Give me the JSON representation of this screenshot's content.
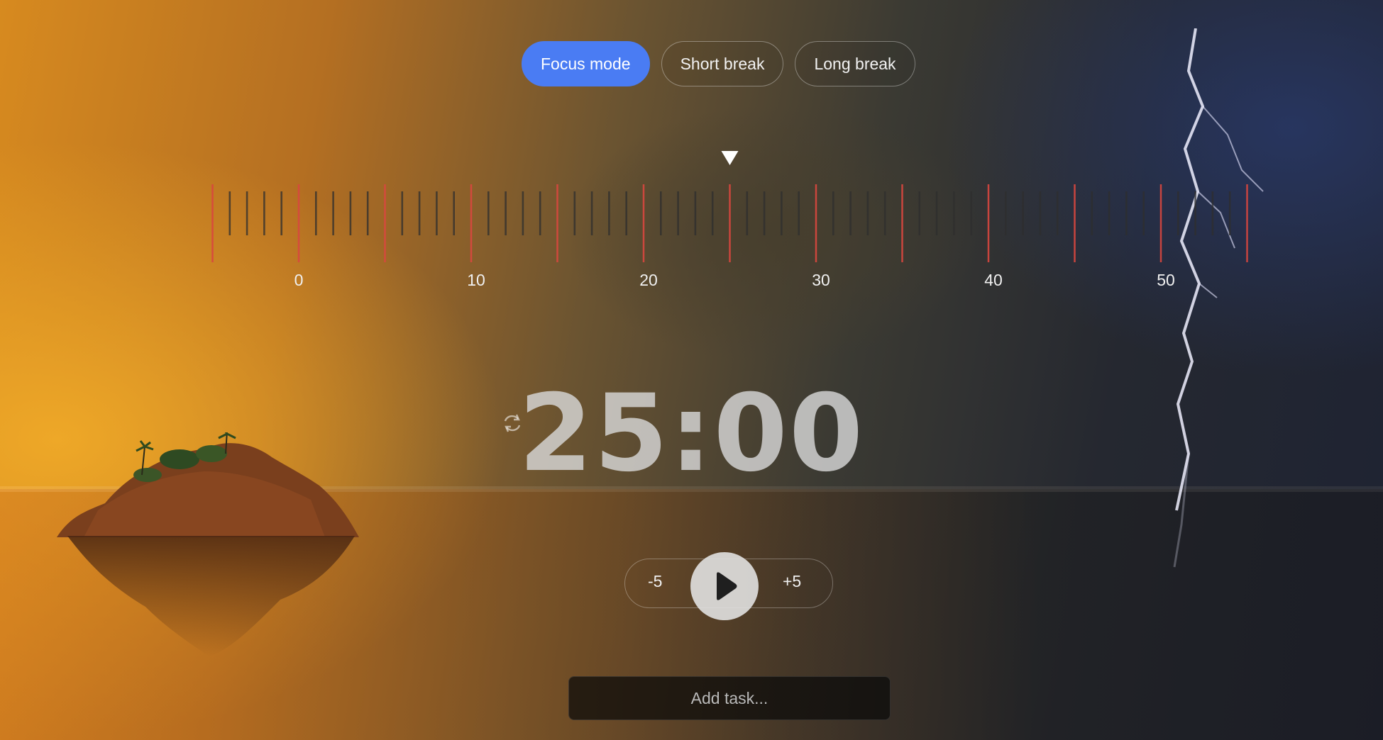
{
  "modes": [
    {
      "label": "Focus mode",
      "active": true
    },
    {
      "label": "Short break",
      "active": false
    },
    {
      "label": "Long break",
      "active": false
    }
  ],
  "ruler": {
    "labels": [
      "0",
      "10",
      "20",
      "30",
      "40",
      "50"
    ],
    "pointer_minutes": 25
  },
  "timer": {
    "display": "25:00"
  },
  "controls": {
    "minus_label": "-5",
    "plus_label": "+5",
    "play_icon": "play-icon"
  },
  "task": {
    "placeholder": "Add task..."
  },
  "icons": {
    "refresh": "refresh-icon"
  },
  "colors": {
    "accent": "#4a7cf3",
    "major_tick": "#d9473f",
    "minor_tick": "#2e2e2e"
  }
}
